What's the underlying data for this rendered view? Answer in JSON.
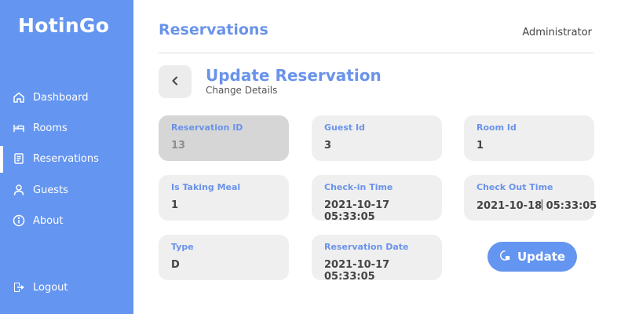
{
  "brand": "HotinGo",
  "nav": [
    {
      "label": "Dashboard",
      "icon": "home-icon"
    },
    {
      "label": "Rooms",
      "icon": "bed-icon"
    },
    {
      "label": "Reservations",
      "icon": "list-icon",
      "active": true
    },
    {
      "label": "Guests",
      "icon": "user-icon"
    },
    {
      "label": "About",
      "icon": "info-icon"
    }
  ],
  "logout": {
    "label": "Logout",
    "icon": "logout-icon"
  },
  "header": {
    "title": "Reservations",
    "user": "Administrator"
  },
  "form": {
    "title": "Update Reservation",
    "subtitle": "Change Details",
    "fields": {
      "reservation_id": {
        "label": "Reservation ID",
        "value": "13"
      },
      "guest_id": {
        "label": "Guest Id",
        "value": "3"
      },
      "room_id": {
        "label": "Room Id",
        "value": "1"
      },
      "is_taking_meal": {
        "label": "Is Taking Meal",
        "value": "1"
      },
      "check_in": {
        "label": "Check-in Time",
        "value": "2021-10-17 05:33:05"
      },
      "check_out": {
        "label": "Check Out Time",
        "value_before_cursor": "2021-10-18",
        "value_after_cursor": " 05:33:05"
      },
      "type": {
        "label": "Type",
        "value": "D"
      },
      "reservation_date": {
        "label": "Reservation Date",
        "value": "2021-10-17 05:33:05"
      }
    },
    "update_label": "Update"
  },
  "colors": {
    "accent": "#6495f0",
    "heading": "#6a93ea",
    "field_bg": "#efefef",
    "disabled_bg": "#d6d6d6"
  }
}
